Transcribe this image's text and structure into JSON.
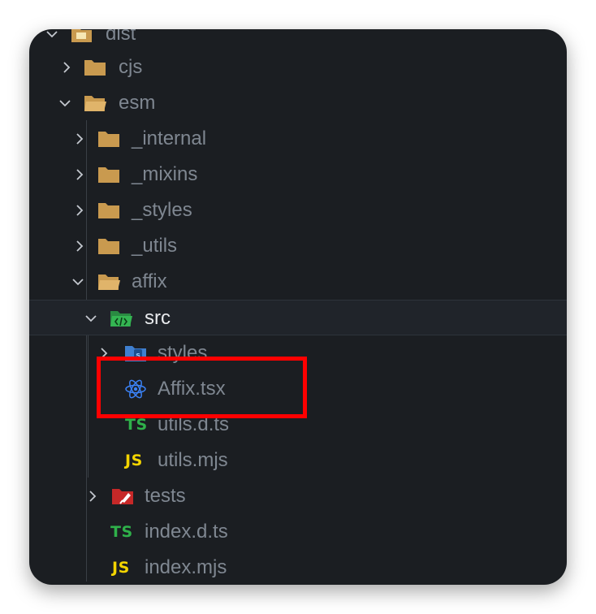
{
  "tree": {
    "root": {
      "label": "dist",
      "icon": "folder-open-icon"
    },
    "items": [
      {
        "label": "cjs",
        "icon": "folder-icon",
        "expanded": false
      },
      {
        "label": "esm",
        "icon": "folder-open-icon",
        "expanded": true
      },
      {
        "label": "_internal",
        "icon": "folder-icon",
        "expanded": false
      },
      {
        "label": "_mixins",
        "icon": "folder-icon",
        "expanded": false
      },
      {
        "label": "_styles",
        "icon": "folder-icon",
        "expanded": false
      },
      {
        "label": "_utils",
        "icon": "folder-icon",
        "expanded": false
      },
      {
        "label": "affix",
        "icon": "folder-open-icon",
        "expanded": true
      },
      {
        "label": "src",
        "icon": "src-folder-icon",
        "expanded": true,
        "selected": true
      },
      {
        "label": "styles",
        "icon": "styles-folder-icon",
        "expanded": false
      },
      {
        "label": "Affix.tsx",
        "icon": "react-icon"
      },
      {
        "label": "utils.d.ts",
        "icon": "typescript-icon",
        "badge": "TS"
      },
      {
        "label": "utils.mjs",
        "icon": "javascript-icon",
        "badge": "JS"
      },
      {
        "label": "tests",
        "icon": "tests-folder-icon",
        "expanded": false
      },
      {
        "label": "index.d.ts",
        "icon": "typescript-icon",
        "badge": "TS"
      },
      {
        "label": "index.mjs",
        "icon": "javascript-icon",
        "badge": "JS"
      }
    ]
  },
  "colors": {
    "background": "#1b1e22",
    "folder": "#c99a4f",
    "highlight_box": "#ff0000",
    "ts_badge": "#2fb14a",
    "js_badge": "#f3d400",
    "react": "#3b82f6",
    "src_folder": "#2fa84f",
    "tests_folder": "#c62828"
  }
}
